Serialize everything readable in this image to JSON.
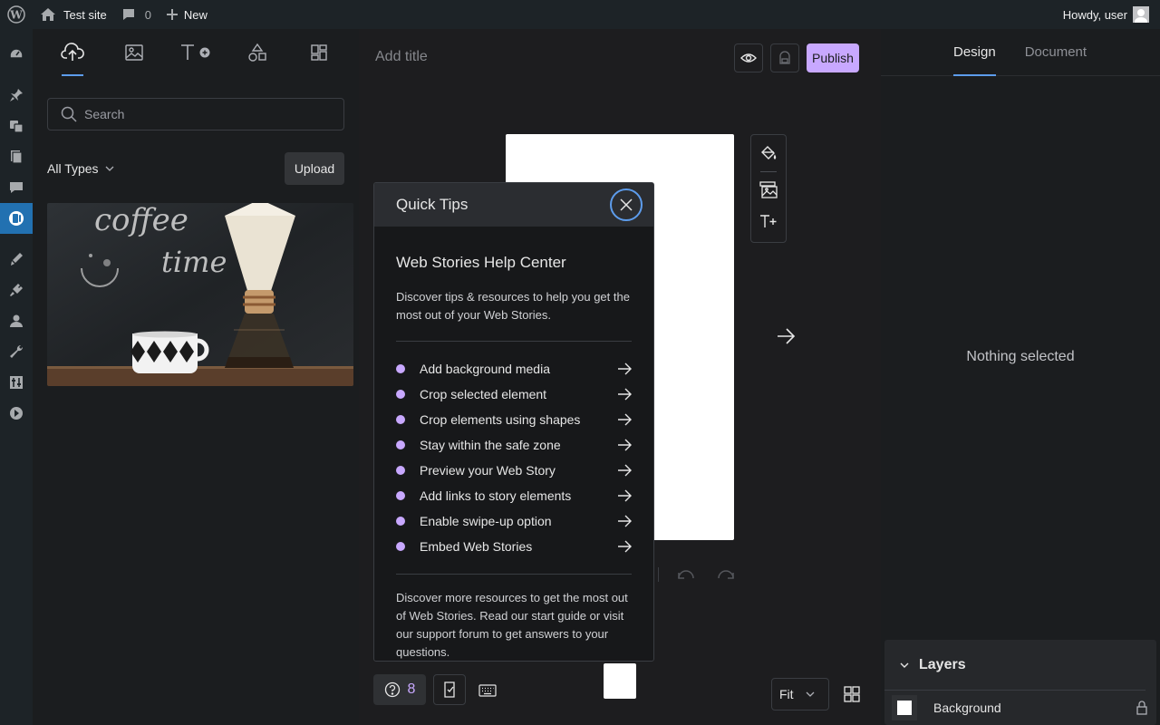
{
  "adminbar": {
    "site_name": "Test site",
    "comments_count": "0",
    "new_label": "New",
    "howdy": "Howdy, user"
  },
  "library": {
    "search_placeholder": "Search",
    "types_label": "All Types",
    "upload_label": "Upload",
    "media": [
      {
        "chalk_line1": "coffee",
        "chalk_line2": "time"
      }
    ]
  },
  "editor": {
    "title_placeholder": "Add title",
    "publish_label": "Publish",
    "help_count": "8",
    "zoom_value": "Fit"
  },
  "quicktips": {
    "header": "Quick Tips",
    "title": "Web Stories Help Center",
    "description": "Discover tips & resources to help you get the most out of your Web Stories.",
    "tips": [
      "Add background media",
      "Crop selected element",
      "Crop elements using shapes",
      "Stay within the safe zone",
      "Preview your Web Story",
      "Add links to story elements",
      "Enable swipe-up option",
      "Embed Web Stories"
    ],
    "footer": "Discover more resources to get the most out of Web Stories. Read our start guide or visit our support forum to get answers to your questions."
  },
  "inspector": {
    "tabs": [
      "Design",
      "Document"
    ],
    "empty_state": "Nothing selected",
    "layers_title": "Layers",
    "layers": [
      "Background"
    ]
  },
  "colors": {
    "accent": "#c8a8ff",
    "focus": "#5d9cec",
    "wp_active": "#2271b1"
  }
}
